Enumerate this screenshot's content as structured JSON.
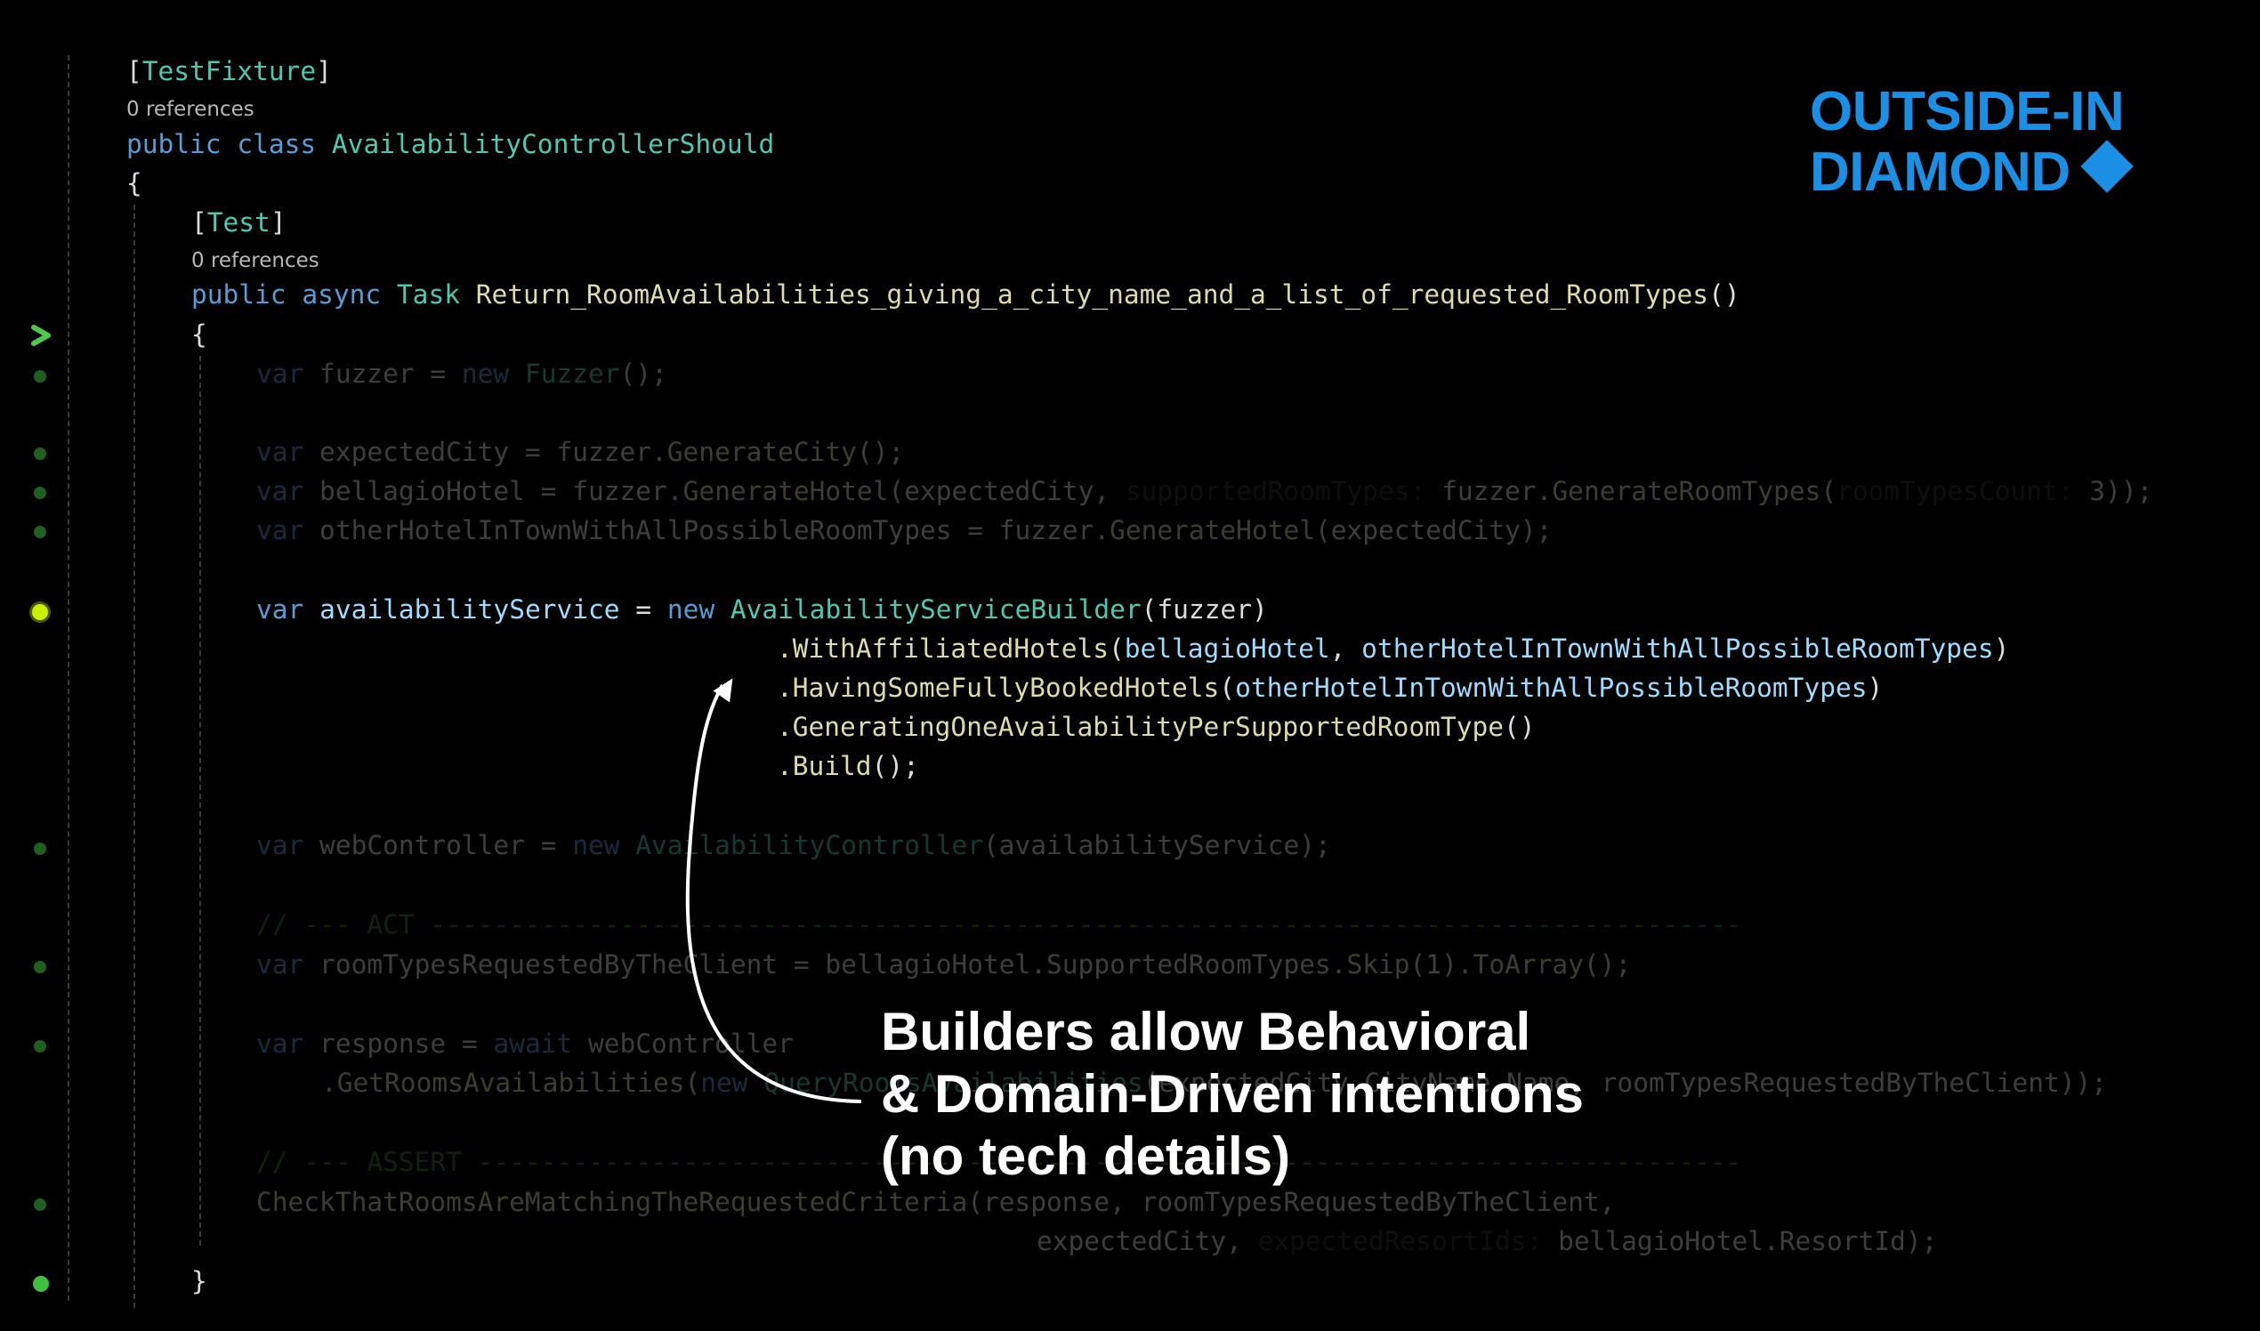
{
  "brand": {
    "line1": "OUTSIDE-IN",
    "line2": "DIAMOND",
    "color": "#1a8fe3",
    "icon": "diamond-icon"
  },
  "callout": {
    "line1": "Builders allow Behavioral",
    "line2": "& Domain-Driven intentions",
    "line3": "(no tech details)",
    "arrow_icon": "curved-arrow-icon"
  },
  "code": {
    "attr_fixture": {
      "open": "[",
      "name": "TestFixture",
      "close": "]"
    },
    "refs_class": "0 references",
    "class_decl": {
      "kw1": "public",
      "kw2": "class",
      "name": "AvailabilityControllerShould"
    },
    "brace_open_class": "{",
    "attr_test": {
      "open": "[",
      "name": "Test",
      "close": "]"
    },
    "refs_method": "0 references",
    "method_decl": {
      "kw1": "public",
      "kw2": "async",
      "type": "Task",
      "name": "Return_RoomAvailabilities_giving_a_city_name_and_a_list_of_requested_RoomTypes",
      "parens": "()"
    },
    "brace_open_method": "{",
    "line_fuzzer": {
      "kw": "var",
      "rest": " fuzzer = ",
      "kw_new": "new",
      "type": "Fuzzer",
      "end": "();"
    },
    "line_city": {
      "kw": "var",
      "rest": " expectedCity = fuzzer.",
      "fn": "GenerateCity",
      "end": "();"
    },
    "line_bellagio": {
      "kw": "var",
      "rest": " bellagioHotel = fuzzer.",
      "fn": "GenerateHotel",
      "mid": "(expectedCity, ",
      "label": "supportedRoomTypes:",
      "rest2": " fuzzer.",
      "fn2": "GenerateRoomTypes",
      "mid2": "(",
      "label2": "roomTypesCount:",
      "end": " 3));"
    },
    "line_other": {
      "kw": "var",
      "rest": " otherHotelInTownWithAllPossibleRoomTypes = fuzzer.",
      "fn": "GenerateHotel",
      "end": "(expectedCity);"
    },
    "line_service": {
      "kw": "var",
      "var": "availabilityService",
      "eq": " = ",
      "kw_new": "new",
      "type": "AvailabilityServiceBuilder",
      "end": "(fuzzer)"
    },
    "chain_1": {
      "fn": ".WithAffiliatedHotels",
      "p1": "bellagioHotel",
      "p2": "otherHotelInTownWithAllPossibleRoomTypes"
    },
    "chain_2": {
      "fn": ".HavingSomeFullyBookedHotels",
      "p1": "otherHotelInTownWithAllPossibleRoomTypes"
    },
    "chain_3": {
      "fn": ".GeneratingOneAvailabilityPerSupportedRoomType",
      "end": "()"
    },
    "chain_4": {
      "fn": ".Build",
      "end": "();"
    },
    "line_controller": {
      "kw": "var",
      "rest": " webController = ",
      "kw_new": "new",
      "type": "AvailabilityController",
      "end": "(availabilityService);"
    },
    "comment_act": "// --- ACT -----------------------------------------------------------------------------------",
    "line_requested": {
      "kw": "var",
      "rest": " roomTypesRequestedByTheClient = bellagioHotel.SupportedRoomTypes.",
      "fn": "Skip",
      "mid": "(1).",
      "fn2": "ToArray",
      "end": "();"
    },
    "line_response": {
      "kw": "var",
      "rest": " response = ",
      "kw_await": "await",
      "end": " webController"
    },
    "line_getrooms": {
      "fn": ".GetRoomsAvailabilities",
      "open": "(",
      "kw_new": "new",
      "type": "QueryRoomsAvailabilities",
      "mid": "(expectedCity.",
      "label": "CityName",
      "end": ".Name, roomTypesRequestedByTheClient));"
    },
    "comment_assert": "// --- ASSERT --------------------------------------------------------------------------------",
    "line_check": {
      "fn": "CheckThatRoomsAreMatchingTheRequestedCriteria",
      "end": "(response, roomTypesRequestedByTheClient,"
    },
    "line_check2": {
      "rest": "expectedCity, ",
      "label": "expectedResortIds:",
      "end": " bellagioHotel.ResortId);"
    },
    "brace_close_method": "}"
  },
  "gutter": {
    "exec_arrow_color": "#4ec94e",
    "breakpoint_color": "#3fbf3f",
    "active_breakpoint_color": "#c8f000"
  }
}
